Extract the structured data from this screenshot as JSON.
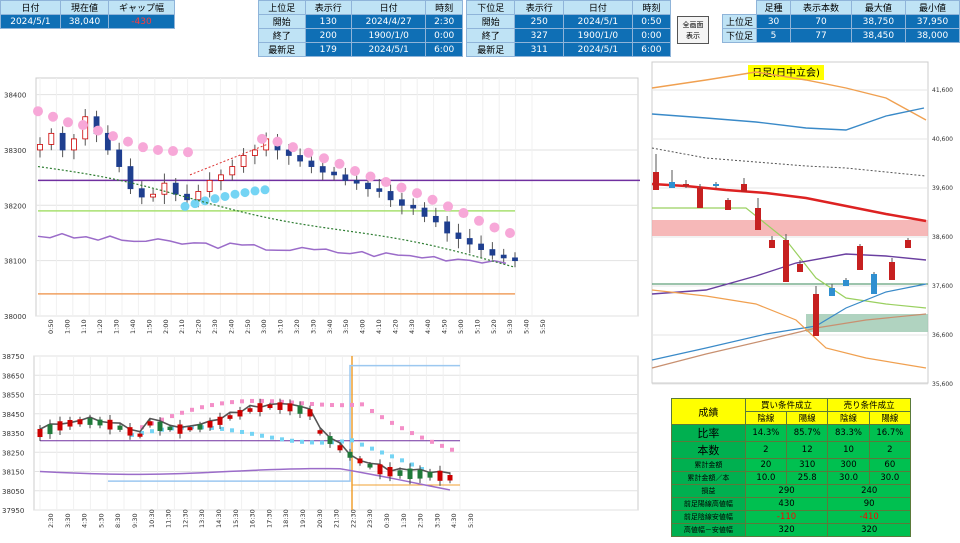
{
  "left_header": {
    "headers": [
      "日付",
      "現在値",
      "ギャップ幅"
    ],
    "values": [
      "2024/5/1",
      "38,040",
      "-430"
    ]
  },
  "upper": {
    "headers": [
      "上位足",
      "表示行",
      "日付",
      "時刻"
    ],
    "rows": [
      [
        "開始",
        "130",
        "2024/4/27",
        "2:30"
      ],
      [
        "終了",
        "200",
        "1900/1/0",
        "0:00"
      ],
      [
        "最新足",
        "179",
        "2024/5/1",
        "6:00"
      ]
    ]
  },
  "lower": {
    "headers": [
      "下位足",
      "表示行",
      "日付",
      "時刻"
    ],
    "rows": [
      [
        "開始",
        "250",
        "2024/5/1",
        "0:50"
      ],
      [
        "終了",
        "327",
        "1900/1/0",
        "0:00"
      ],
      [
        "最新足",
        "311",
        "2024/5/1",
        "6:00"
      ]
    ]
  },
  "full_screen_button": {
    "line1": "全画面",
    "line2": "表示"
  },
  "range_table": {
    "headers": [
      "足種",
      "表示本数",
      "最大値",
      "最小値"
    ],
    "rows": [
      [
        "上位足",
        "30",
        "70",
        "38,750",
        "37,950"
      ],
      [
        "下位足",
        "5",
        "77",
        "38,450",
        "38,000"
      ]
    ]
  },
  "stats": {
    "title": "成績",
    "buy": "買い条件成立",
    "sell": "売り条件成立",
    "sub": [
      "陰線",
      "陽線",
      "陰線",
      "陽線"
    ],
    "rows": [
      {
        "label": "比率",
        "vals": [
          "14.3%",
          "85.7%",
          "83.3%",
          "16.7%"
        ]
      },
      {
        "label": "本数",
        "vals": [
          "2",
          "12",
          "10",
          "2"
        ]
      },
      {
        "label": "累計金額",
        "vals": [
          "20",
          "310",
          "300",
          "60"
        ]
      },
      {
        "label": "累計金額／本",
        "vals": [
          "10.0",
          "25.8",
          "30.0",
          "30.0"
        ]
      }
    ],
    "merged": [
      {
        "label": "損益",
        "vals": [
          "290",
          "240"
        ],
        "neg": false
      },
      {
        "label": "前足陽線高値幅",
        "vals": [
          "430",
          "90"
        ],
        "neg": false
      },
      {
        "label": "前足陰線安値幅",
        "vals": [
          "-110",
          "-410"
        ],
        "neg": true
      },
      {
        "label": "高値幅－安値幅",
        "vals": [
          "320",
          "320"
        ],
        "neg": false
      }
    ]
  },
  "chart_data": [
    {
      "type": "line",
      "title": "",
      "y_ticks": [
        "38400",
        "38300",
        "38200",
        "38100",
        "38000"
      ],
      "ylim": [
        38000,
        38430
      ],
      "x_ticks": [
        "0:50",
        "1:00",
        "1:10",
        "1:20",
        "1:30",
        "1:40",
        "1:50",
        "2:00",
        "2:10",
        "2:20",
        "2:30",
        "2:40",
        "2:50",
        "3:00",
        "3:10",
        "3:20",
        "3:30",
        "3:40",
        "3:50",
        "4:00",
        "4:10",
        "4:20",
        "4:30",
        "4:40",
        "4:50",
        "5:00",
        "5:10",
        "5:20",
        "5:30",
        "5:40",
        "5:50"
      ],
      "close": [
        38310,
        38330,
        38300,
        38320,
        38360,
        38330,
        38300,
        38270,
        38230,
        38215,
        38220,
        38240,
        38220,
        38210,
        38225,
        38245,
        38255,
        38270,
        38290,
        38300,
        38320,
        38300,
        38290,
        38280,
        38270,
        38260,
        38255,
        38245,
        38240,
        38230,
        38225,
        38210,
        38200,
        38195,
        38180,
        38170,
        38150,
        38140,
        38130,
        38120,
        38110,
        38105,
        38100
      ]
    },
    {
      "type": "line",
      "title": "",
      "y_ticks": [
        "38750",
        "38650",
        "38550",
        "38450",
        "38350",
        "38250",
        "38150",
        "38050",
        "37950"
      ],
      "ylim": [
        37950,
        38750
      ],
      "x_ticks": [
        "2:30",
        "3:30",
        "4:30",
        "5:30",
        "8:30",
        "9:30",
        "10:30",
        "11:30",
        "12:30",
        "13:30",
        "14:30",
        "15:30",
        "16:30",
        "17:30",
        "18:30",
        "19:30",
        "20:30",
        "21:30",
        "22:30",
        "23:30",
        "0:30",
        "1:30",
        "2:30",
        "3:30",
        "4:30",
        "5:30"
      ]
    },
    {
      "type": "line",
      "title": "日足(日中立会)",
      "y_ticks": [
        "41,600",
        "40,600",
        "39,600",
        "38,600",
        "37,600",
        "36,600",
        "35,600"
      ],
      "ylim": [
        35600,
        41600
      ]
    }
  ]
}
